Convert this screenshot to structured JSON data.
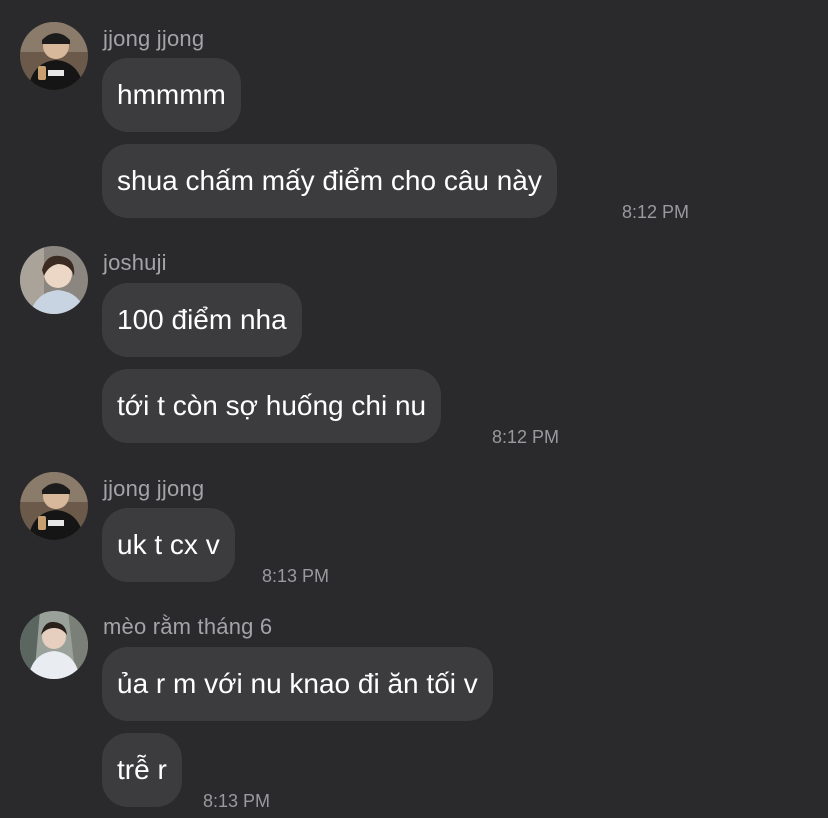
{
  "messages": [
    {
      "sender": "jjong jjong",
      "avatar_icon": "avatar-photo-icon",
      "bubbles": [
        "hmmmm",
        "shua chấm mấy điểm cho câu này"
      ],
      "time": "8:12 PM"
    },
    {
      "sender": "joshuji",
      "avatar_icon": "avatar-photo-icon",
      "bubbles": [
        "100 điểm nha",
        "tới t còn sợ huống chi nu"
      ],
      "time": "8:12 PM"
    },
    {
      "sender": "jjong jjong",
      "avatar_icon": "avatar-photo-icon",
      "bubbles": [
        "uk t cx v"
      ],
      "time": "8:13 PM"
    },
    {
      "sender": "mèo rằm tháng 6",
      "avatar_icon": "avatar-photo-icon",
      "bubbles": [
        "ủa r m với nu knao đi ăn tối v",
        "trễ r"
      ],
      "time": "8:13 PM"
    }
  ],
  "colors": {
    "background": "#2a2a2c",
    "bubble": "#3c3c3f",
    "sender_text": "#a4a4a8",
    "message_text": "#ffffff",
    "time_text": "#9a9a9e"
  }
}
